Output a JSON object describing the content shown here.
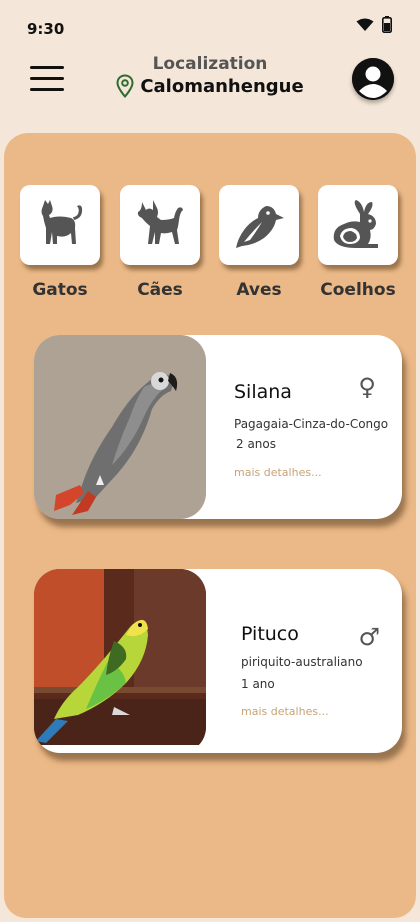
{
  "status": {
    "time": "9:30",
    "icons": [
      "wifi-icon",
      "battery-icon"
    ]
  },
  "header": {
    "menu_icon": "hamburger-menu-icon",
    "location_title": "Localization",
    "location_icon": "location-pin-icon",
    "location_name": "Calomanhengue",
    "avatar_icon": "user-avatar-icon"
  },
  "categories": [
    {
      "label": "Gatos",
      "icon": "cat-icon"
    },
    {
      "label": "Cães",
      "icon": "dog-icon"
    },
    {
      "label": "Aves",
      "icon": "bird-icon"
    },
    {
      "label": "Coelhos",
      "icon": "rabbit-icon"
    }
  ],
  "pets": [
    {
      "name": "Silana",
      "species": "Pagagaia-Cinza-do-Congo",
      "age": "2 anos",
      "gender_symbol": "♀",
      "gender_icon": "female-icon",
      "more": "mais detalhes..."
    },
    {
      "name": "Pituco",
      "species": "piriquito-australiano",
      "age": "1 ano",
      "gender_symbol": "♂",
      "gender_icon": "male-icon",
      "more": "mais detalhes..."
    }
  ],
  "colors": {
    "background": "#f4e7d9",
    "panel": "#ebb987",
    "accent_link": "#c7a276",
    "icon_grey": "#555555"
  }
}
